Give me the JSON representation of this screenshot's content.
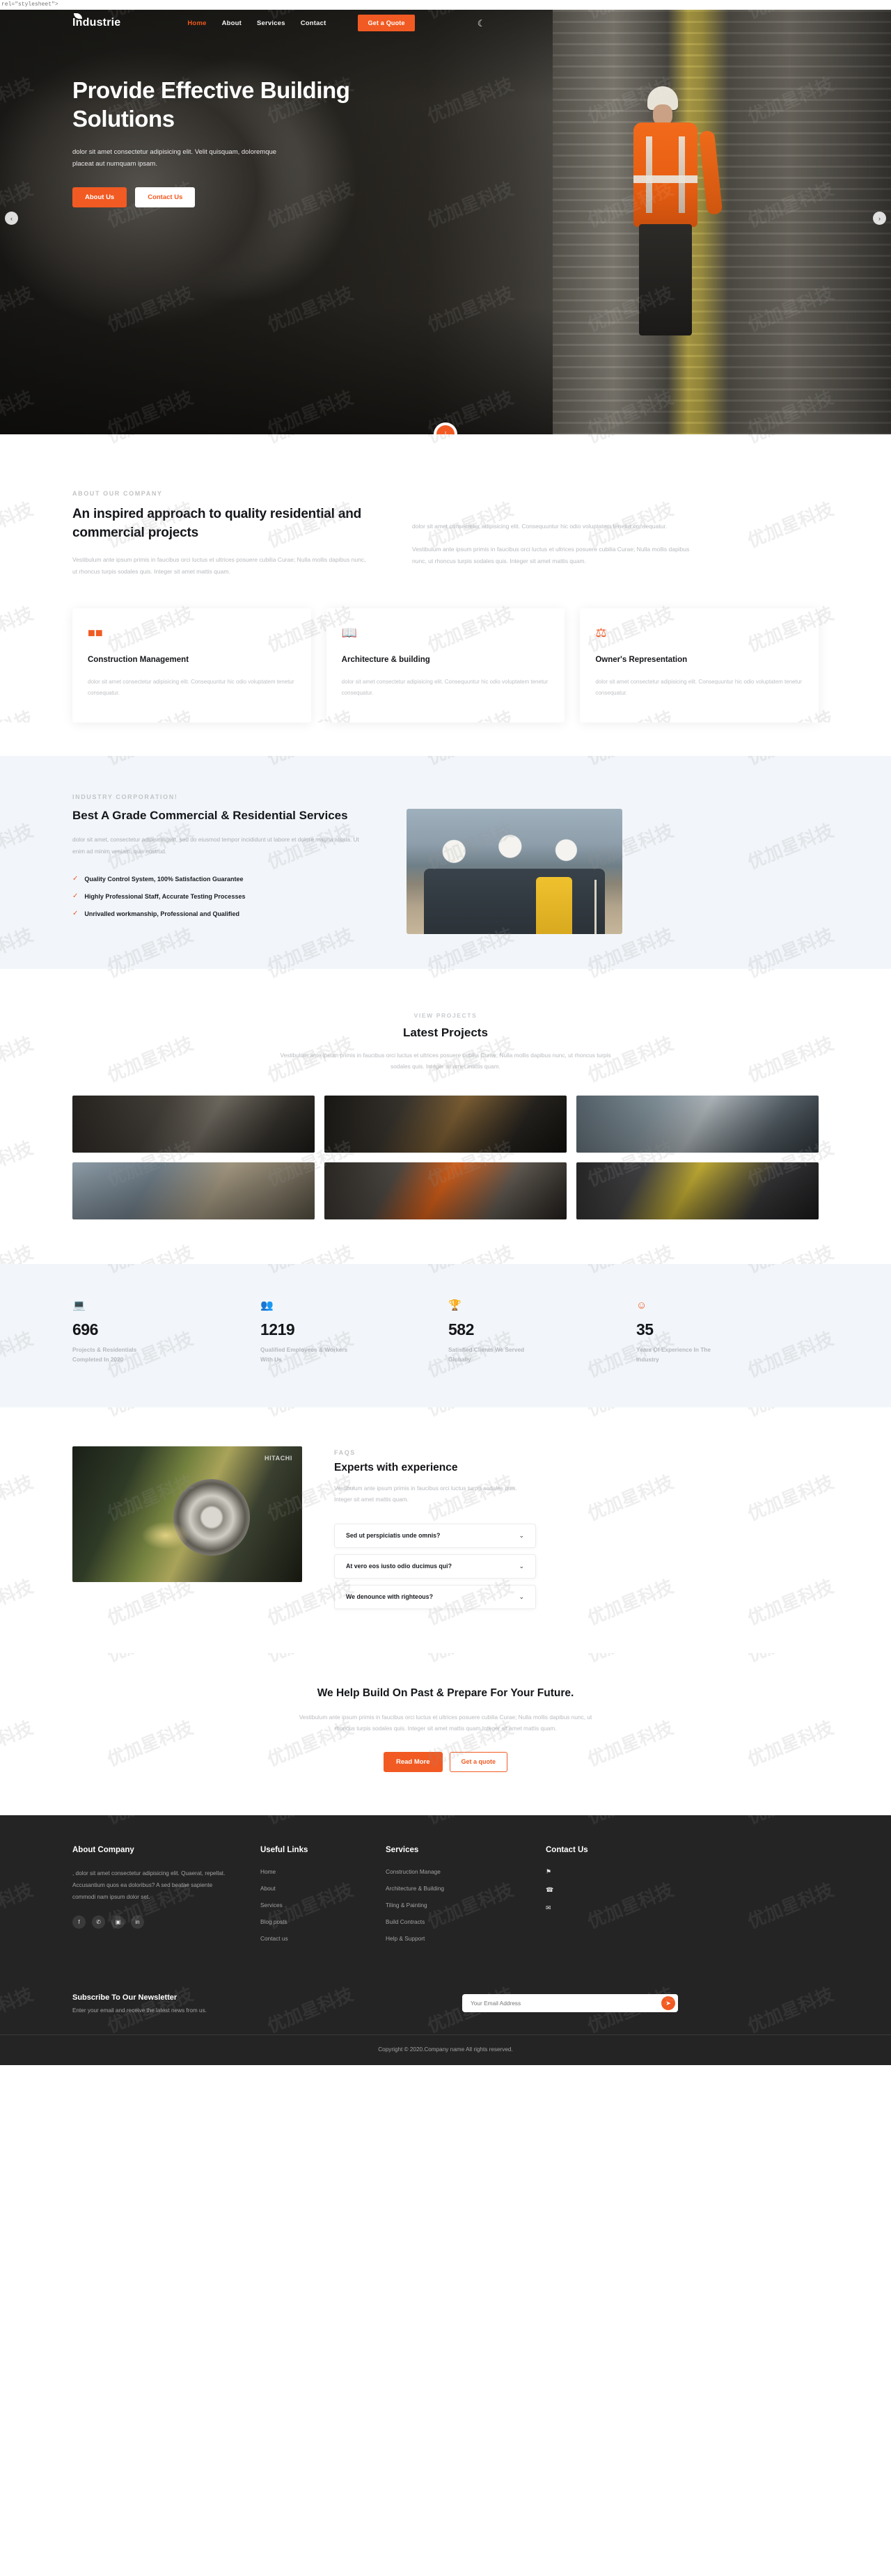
{
  "browser_artifact": "rel=\"stylesheet\">",
  "nav": {
    "brand": "Industrie",
    "links": [
      {
        "label": "Home",
        "active": true
      },
      {
        "label": "About",
        "active": false
      },
      {
        "label": "Services",
        "active": false
      },
      {
        "label": "Contact",
        "active": false
      }
    ],
    "quote_button": "Get a Quote",
    "theme_toggle_icon": "moon-icon"
  },
  "hero": {
    "title": "Provide Effective Building Solutions",
    "subtitle": "dolor sit amet consectetur adipisicing elit. Velit quisquam, doloremque placeat aut numquam ipsam.",
    "primary_button": "About Us",
    "secondary_button": "Contact Us",
    "prev_arrow": "‹",
    "next_arrow": "›",
    "scroll_badge_icon": "arrow-down-icon"
  },
  "about": {
    "eyebrow": "ABOUT OUR COMPANY",
    "heading": "An inspired approach to quality residential and commercial projects",
    "paragraph": "Vestibulum ante ipsum primis in faucibus orci luctus et ultrices posuere cubilia Curae; Nulla mollis dapibus nunc, ut rhoncus turpis sodales quis. Integer sit amet mattis quam.",
    "right_paragraph_1": "dolor sit amet consectetur adipisicing elit. Consequuntur hic odio voluptatem tenetur consequatur.",
    "right_paragraph_2": "Vestibulum ante ipsum primis in faucibus orci luctus et ultrices posuere cubilia Curae; Nulla mollis dapibus nunc, ut rhoncus turpis sodales quis. Integer sit amet mattis quam.",
    "cards": [
      {
        "icon": "blocks-icon",
        "title": "Construction Management",
        "text": "dolor sit amet consectetur adipisicing elit. Consequuntur hic odio voluptatem tenetur consequatur."
      },
      {
        "icon": "book-icon",
        "title": "Architecture & building",
        "text": "dolor sit amet consectetur adipisicing elit. Consequuntur hic odio voluptatem tenetur consequatur."
      },
      {
        "icon": "shield-icon",
        "title": "Owner's Representation",
        "text": "dolor sit amet consectetur adipisicing elit. Consequuntur hic odio voluptatem tenetur consequatur."
      }
    ]
  },
  "industry": {
    "eyebrow": "INDUSTRY CORPORATION!",
    "heading": "Best A Grade Commercial & Residential Services",
    "paragraph": "dolor sit amet, consectetur adipisicingelit, sed do eiusmod tempor incididunt ut labore et dolore magna aliqua. Ut enim ad minim veniam, quis nostrud.",
    "features": [
      "Quality Control System, 100% Satisfaction Guarantee",
      "Highly Professional Staff, Accurate Testing Processes",
      "Unrivalled workmanship, Professional and Qualified"
    ]
  },
  "projects": {
    "eyebrow": "VIEW PROJECTS",
    "heading": "Latest Projects",
    "lead": "Vestibulum ante ipsum primis in faucibus orci luctus et ultrices posuere cubilia Curae; Nulla mollis dapibus nunc, ut rhoncus turpis sodales quis. Integer sit amet mattis quam.",
    "items": [
      {
        "name": "turbine-rotor-project"
      },
      {
        "name": "grinding-welding-project"
      },
      {
        "name": "rail-maintenance-project"
      },
      {
        "name": "site-survey-team-project"
      },
      {
        "name": "machinery-inspection-project"
      },
      {
        "name": "construction-crew-project"
      }
    ]
  },
  "stats": [
    {
      "icon": "laptop-icon",
      "number": "696",
      "label": "Projects & Residentials Completed In 2020"
    },
    {
      "icon": "people-icon",
      "number": "1219",
      "label": "Qualified Employees & Workers With Us"
    },
    {
      "icon": "trophy-icon",
      "number": "582",
      "label": "Satisfied Clients We Served Globally"
    },
    {
      "icon": "smiley-icon",
      "number": "35",
      "label": "Years Of Experience In The Industry"
    }
  ],
  "faq": {
    "photo_label": "HITACHI",
    "eyebrow": "FAQS",
    "heading": "Experts with experience",
    "paragraph": "Vestibulum ante ipsum primis in faucibus orci luctus turpis sodales quis. Integer sit amet mattis quam.",
    "items": [
      {
        "question": "Sed ut perspiciatis unde omnis?"
      },
      {
        "question": "At vero eos iusto odio ducimus qui?"
      },
      {
        "question": "We denounce with righteous?"
      }
    ]
  },
  "cta": {
    "heading": "We Help Build On Past & Prepare For Your Future.",
    "paragraph": "Vestibulum ante ipsum primis in faucibus orci luctus et ultrices posuere cubilia Curae; Nulla mollis dapibus nunc, ut rhoncus turpis sodales quis. Integer sit amet mattis quam.Integer sit amet mattis quam.",
    "primary_button": "Read More",
    "secondary_button": "Get a quote"
  },
  "footer": {
    "about": {
      "title": "About Company",
      "text": ", dolor sit amet consectetur adipisicing elit. Quaerat, repellat. Accusantium quos ea doloribus? A sed beatae sapiente commodi nam ipsum dolor set.",
      "social": [
        {
          "icon": "facebook-icon",
          "glyph": "f"
        },
        {
          "icon": "twitter-icon",
          "glyph": "✆"
        },
        {
          "icon": "instagram-icon",
          "glyph": "▣"
        },
        {
          "icon": "linkedin-icon",
          "glyph": "in"
        }
      ]
    },
    "useful_links": {
      "title": "Useful Links",
      "links": [
        "Home",
        "About",
        "Services",
        "Blog posts",
        "Contact us"
      ]
    },
    "services": {
      "title": "Services",
      "links": [
        "Construction Manage",
        "Architecture & Building",
        "Tiling & Painting",
        "Build Contracts",
        "Help & Support"
      ]
    },
    "contact": {
      "title": "Contact Us",
      "rows": [
        {
          "icon": "location-pin-icon",
          "glyph": "⚑"
        },
        {
          "icon": "phone-icon",
          "glyph": "☎"
        },
        {
          "icon": "envelope-icon",
          "glyph": "✉"
        }
      ]
    },
    "newsletter": {
      "title": "Subscribe To Our Newsletter",
      "subtitle": "Enter your email and receive the latest news from us.",
      "placeholder": "Your Email Address",
      "value": "",
      "send_icon": "paper-plane-icon"
    },
    "copyright": "Copyright © 2020.Company name All rights reserved."
  },
  "colors": {
    "accent": "#f15a22",
    "dark": "#242424",
    "light_blue": "#f2f6fa"
  },
  "watermark_text": "优加星科技"
}
